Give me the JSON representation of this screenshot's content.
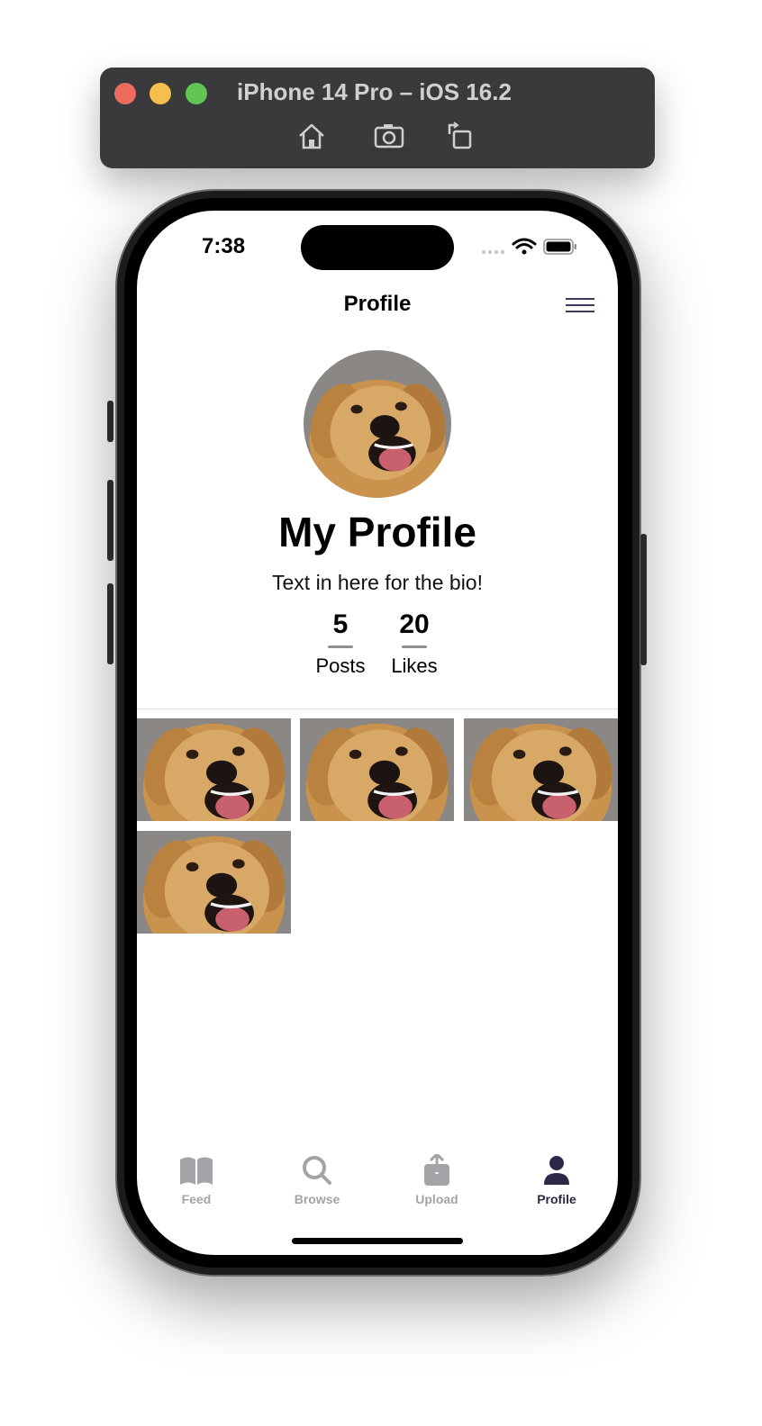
{
  "simulator": {
    "title": "iPhone 14 Pro – iOS 16.2",
    "tools": [
      "home-icon",
      "screenshot-icon",
      "rotate-icon"
    ]
  },
  "status_bar": {
    "time": "7:38",
    "icons": [
      "cellular-dots-icon",
      "wifi-icon",
      "battery-icon"
    ]
  },
  "nav": {
    "title": "Profile",
    "menu_icon": "hamburger-menu-icon"
  },
  "profile": {
    "name": "My Profile",
    "bio": "Text in here for the bio!",
    "avatar_icon": "dog-avatar",
    "stats": [
      {
        "value": "5",
        "label": "Posts"
      },
      {
        "value": "20",
        "label": "Likes"
      }
    ]
  },
  "posts_count": 4,
  "tabs": [
    {
      "label": "Feed",
      "icon": "book-icon",
      "active": false
    },
    {
      "label": "Browse",
      "icon": "search-icon",
      "active": false
    },
    {
      "label": "Upload",
      "icon": "upload-icon",
      "active": false
    },
    {
      "label": "Profile",
      "icon": "person-icon",
      "active": true
    }
  ],
  "colors": {
    "active_tab": "#2c2946",
    "inactive_tab": "#a3a3a8",
    "menu_icon": "#3b3a5c"
  }
}
